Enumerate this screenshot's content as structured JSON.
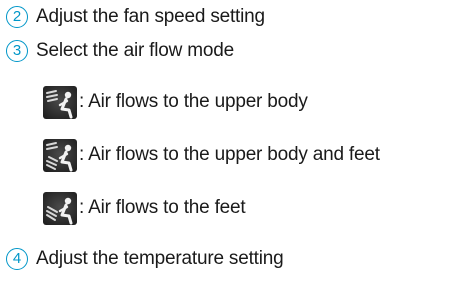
{
  "steps": [
    {
      "number": "2",
      "text": "Adjust the fan speed setting"
    },
    {
      "number": "3",
      "text": "Select the air flow mode"
    },
    {
      "number": "4",
      "text": "Adjust the temperature setting"
    }
  ],
  "modes": [
    {
      "icon": "air-flow-upper-body-icon",
      "text": ": Air flows to the upper body"
    },
    {
      "icon": "air-flow-upper-body-and-feet-icon",
      "text": ": Air flows to the upper body and feet"
    },
    {
      "icon": "air-flow-feet-icon",
      "text": ": Air flows to the feet"
    }
  ],
  "colors": {
    "accent": "#0096c8",
    "text": "#1a1a1a",
    "icon_background": "#2b2b2b"
  }
}
